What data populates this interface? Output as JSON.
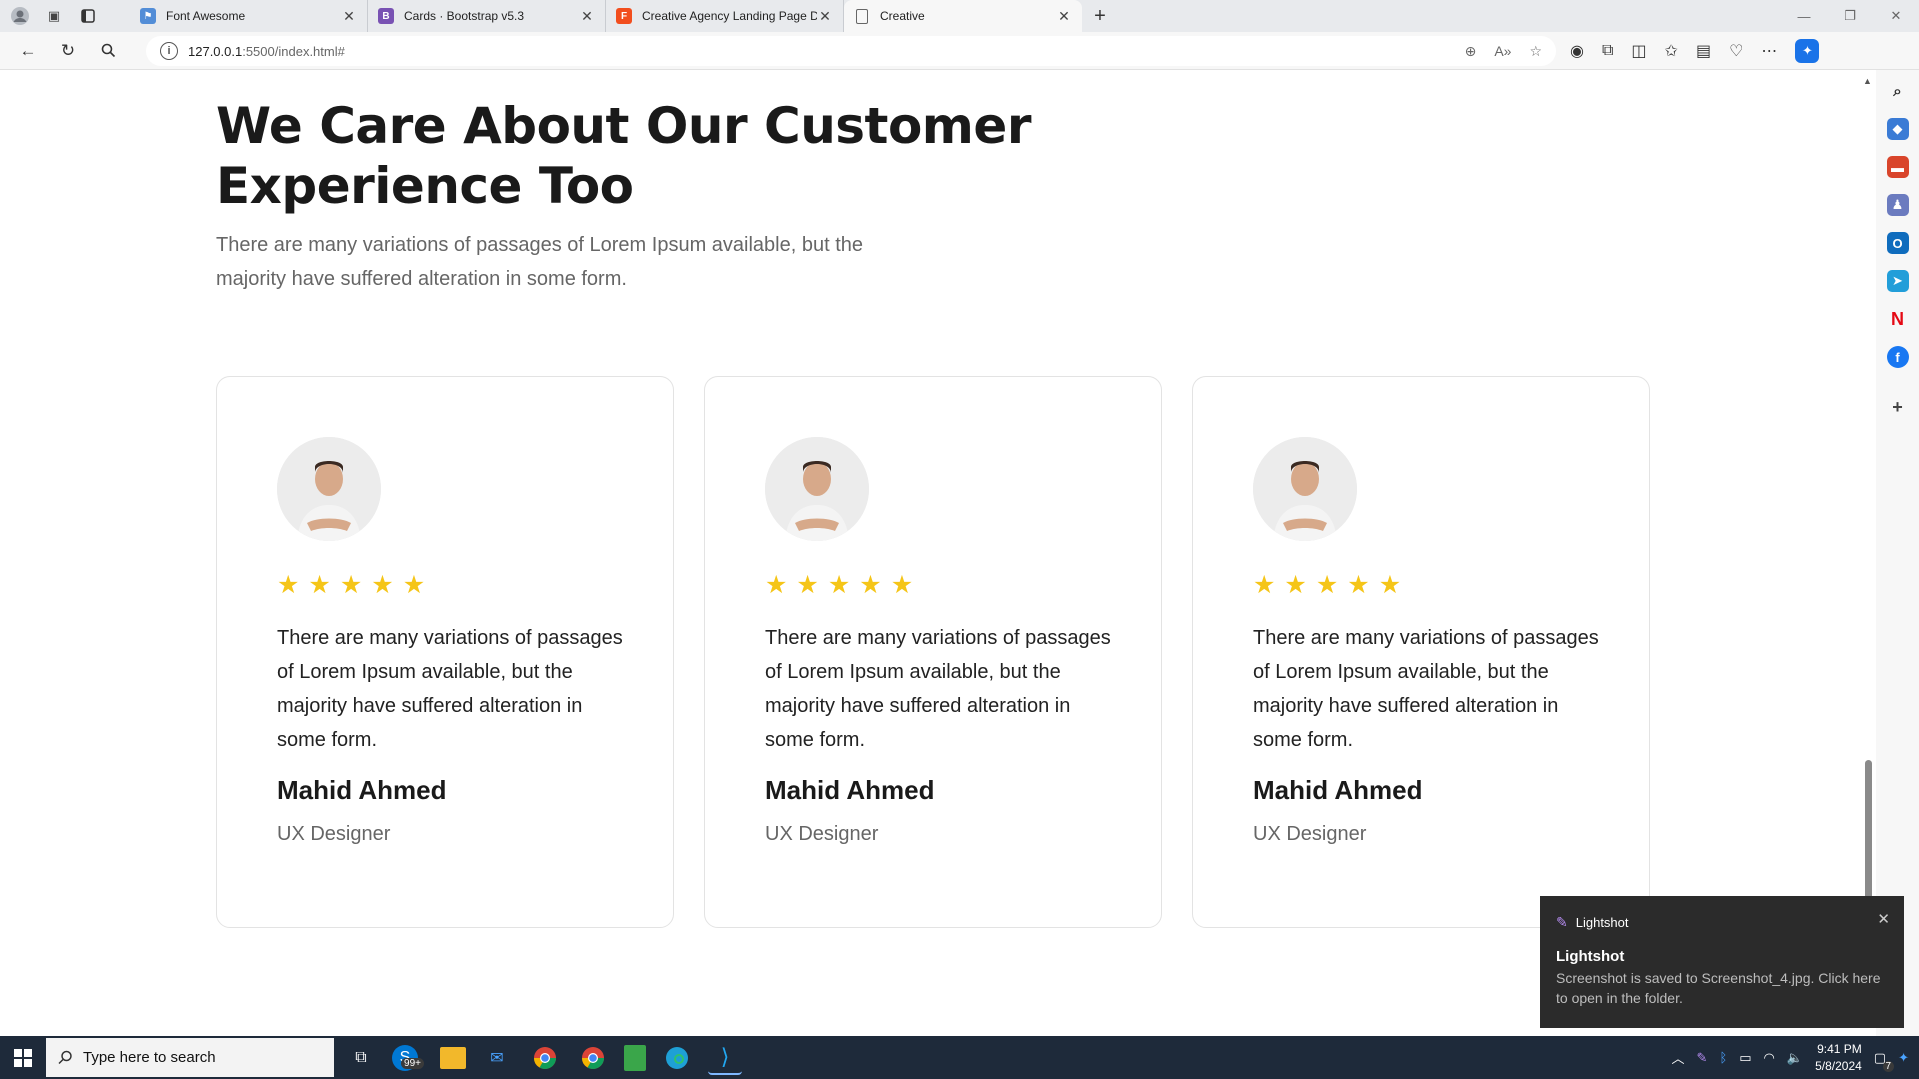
{
  "browser": {
    "tabs": [
      {
        "title": "Font Awesome",
        "favicon_color": "#528dd7"
      },
      {
        "title": "Cards · Bootstrap v5.3",
        "favicon_color": "#7952b3"
      },
      {
        "title": "Creative Agency Landing Page D",
        "favicon_color": "#f24e1e"
      },
      {
        "title": "Creative",
        "favicon_color": "#888888"
      }
    ],
    "url_host": "127.0.0.1",
    "url_path": ":5500/index.html#"
  },
  "page": {
    "heading": "We Care About Our Customer Experience Too",
    "subtext": "There are many variations of passages of Lorem Ipsum available, but the majority have suffered alteration in some form.",
    "cards": [
      {
        "rating": 5,
        "stars": "★★★★★",
        "quote": "There are many variations of passages of Lorem Ipsum available, but the majority have suffered alteration in some form.",
        "name": "Mahid Ahmed",
        "role": "UX Designer"
      },
      {
        "rating": 5,
        "stars": "★★★★★",
        "quote": "There are many variations of passages of Lorem Ipsum available, but the majority have suffered alteration in some form.",
        "name": "Mahid Ahmed",
        "role": "UX Designer"
      },
      {
        "rating": 5,
        "stars": "★★★★★",
        "quote": "There are many variations of passages of Lorem Ipsum available, but the majority have suffered alteration in some form.",
        "name": "Mahid Ahmed",
        "role": "UX Designer"
      }
    ],
    "star_color": "#f5c518"
  },
  "toast": {
    "app": "Lightshot",
    "title": "Lightshot",
    "body": "Screenshot is saved to Screenshot_4.jpg. Click here to open in the folder."
  },
  "taskbar": {
    "search_placeholder": "Type here to search",
    "badge": "99+",
    "time": "9:41 PM",
    "date": "5/8/2024",
    "notification_count": "7"
  }
}
